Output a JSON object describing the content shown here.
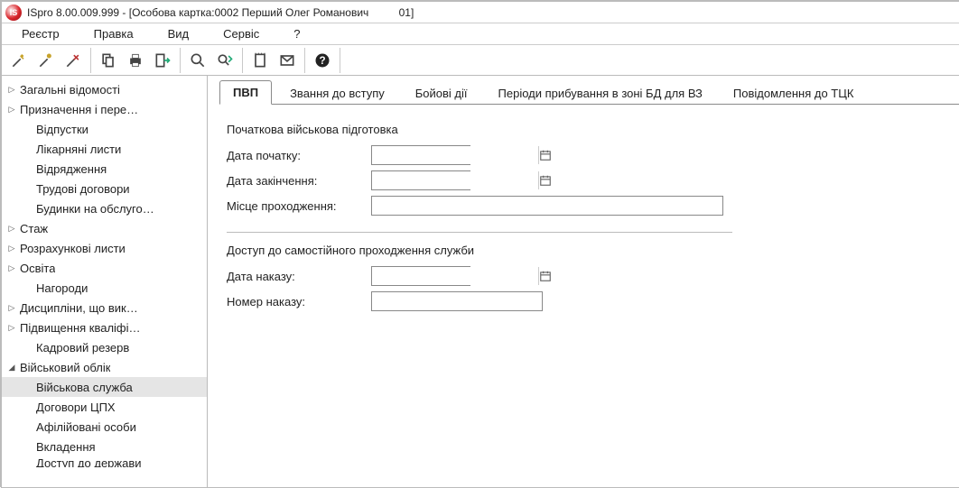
{
  "window": {
    "title": "ISpro 8.00.009.999 - [Особова картка:0002 Перший Олег Романович          01]"
  },
  "menu": {
    "items": [
      "Реєстр",
      "Правка",
      "Вид",
      "Сервіс",
      "?"
    ]
  },
  "toolbar": {
    "icons": [
      "wand-new-icon",
      "wand-edit-icon",
      "wand-delete-icon",
      "copy-icon",
      "print-icon",
      "export-icon",
      "search-icon",
      "search-next-icon",
      "note-icon",
      "mail-icon",
      "help-icon"
    ]
  },
  "tree": {
    "items": [
      {
        "label": "Загальні відомості",
        "expandable": true,
        "expanded": false
      },
      {
        "label": "Призначення і пере…",
        "expandable": true,
        "expanded": false
      },
      {
        "label": "Відпустки",
        "child": true
      },
      {
        "label": "Лікарняні листи",
        "child": true
      },
      {
        "label": "Відрядження",
        "child": true
      },
      {
        "label": "Трудові договори",
        "child": true
      },
      {
        "label": "Будинки на обслуго…",
        "child": true
      },
      {
        "label": "Стаж",
        "expandable": true,
        "expanded": false
      },
      {
        "label": "Розрахункові листи",
        "expandable": true,
        "expanded": false
      },
      {
        "label": "Освіта",
        "expandable": true,
        "expanded": false
      },
      {
        "label": "Нагороди",
        "child": true
      },
      {
        "label": "Дисципліни, що вик…",
        "expandable": true,
        "expanded": false
      },
      {
        "label": "Підвищення кваліфі…",
        "expandable": true,
        "expanded": false
      },
      {
        "label": "Кадровий резерв",
        "child": true
      },
      {
        "label": "Військовий облік",
        "expandable": true,
        "expanded": true
      },
      {
        "label": "Військова служба",
        "child": true,
        "selected": true
      },
      {
        "label": "Договори ЦПХ",
        "child": true
      },
      {
        "label": "Афілійовані особи",
        "child": true
      },
      {
        "label": "Вкладення",
        "child": true
      },
      {
        "label": "Доступ до держави",
        "child": true,
        "cut": true
      }
    ]
  },
  "tabs": {
    "items": [
      {
        "label": "ПВП",
        "active": true
      },
      {
        "label": "Звання до вступу"
      },
      {
        "label": "Бойові дії"
      },
      {
        "label": "Періоди прибування в зоні БД для ВЗ"
      },
      {
        "label": "Повідомлення до ТЦК"
      }
    ]
  },
  "form": {
    "section1_title": "Початкова військова підготовка",
    "start_date_label": "Дата початку:",
    "start_date_value": "",
    "end_date_label": "Дата закінчення:",
    "end_date_value": "",
    "place_label": "Місце проходження:",
    "place_value": "",
    "section2_title": "Доступ до самостійного проходження служби",
    "order_date_label": "Дата наказу:",
    "order_date_value": "",
    "order_num_label": "Номер наказу:",
    "order_num_value": ""
  }
}
